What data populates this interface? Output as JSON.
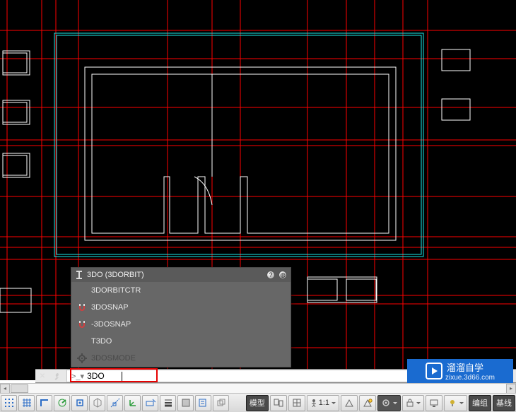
{
  "suggest": {
    "header": "3DO (3DORBIT)",
    "items": [
      {
        "label": "3DORBITCTR",
        "icon": null
      },
      {
        "label": "3DOSNAP",
        "icon": "magnet"
      },
      {
        "label": "-3DOSNAP",
        "icon": "magnet"
      },
      {
        "label": "T3DO",
        "icon": null
      }
    ],
    "dim_item": "3DOSMODE"
  },
  "command": {
    "prefix": ">_▾",
    "typed": "3DO"
  },
  "status": {
    "model": "模型",
    "scale": "1:1",
    "edit_group": "编组",
    "baseline": "基线"
  },
  "watermark": {
    "title": "溜溜自学",
    "sub": "zixue.3d66.com"
  },
  "icons": {
    "x": "✕",
    "wrench": "🔧",
    "help": "?",
    "globe": "◍",
    "human": "人",
    "triangle": "▲"
  }
}
